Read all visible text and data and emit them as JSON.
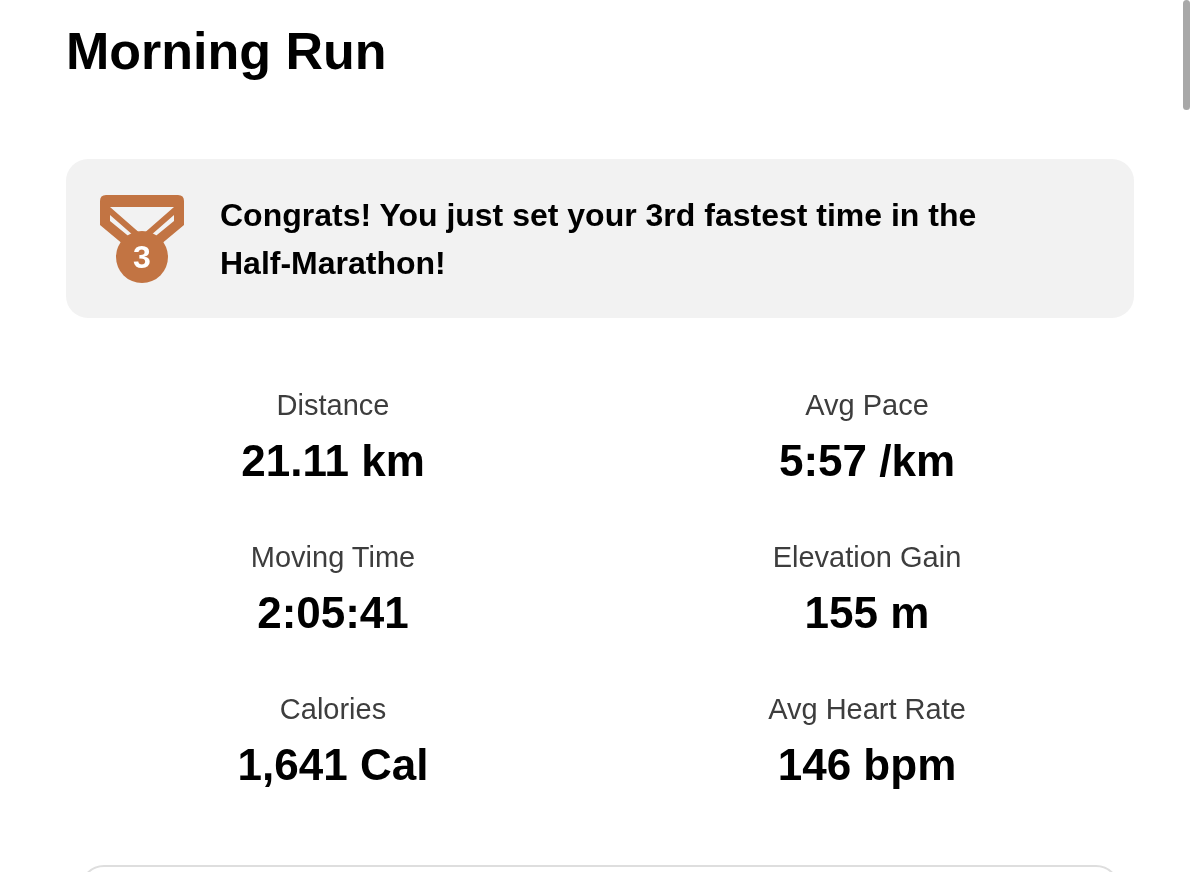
{
  "title": "Morning Run",
  "achievement": {
    "medal_rank": "3",
    "message": "Congrats! You just set your 3rd fastest time in the Half-Marathon!"
  },
  "stats": [
    {
      "label": "Distance",
      "value": "21.11 km"
    },
    {
      "label": "Avg Pace",
      "value": "5:57 /km"
    },
    {
      "label": "Moving Time",
      "value": "2:05:41"
    },
    {
      "label": "Elevation Gain",
      "value": "155 m"
    },
    {
      "label": "Calories",
      "value": "1,641 Cal"
    },
    {
      "label": "Avg Heart Rate",
      "value": "146 bpm"
    }
  ]
}
